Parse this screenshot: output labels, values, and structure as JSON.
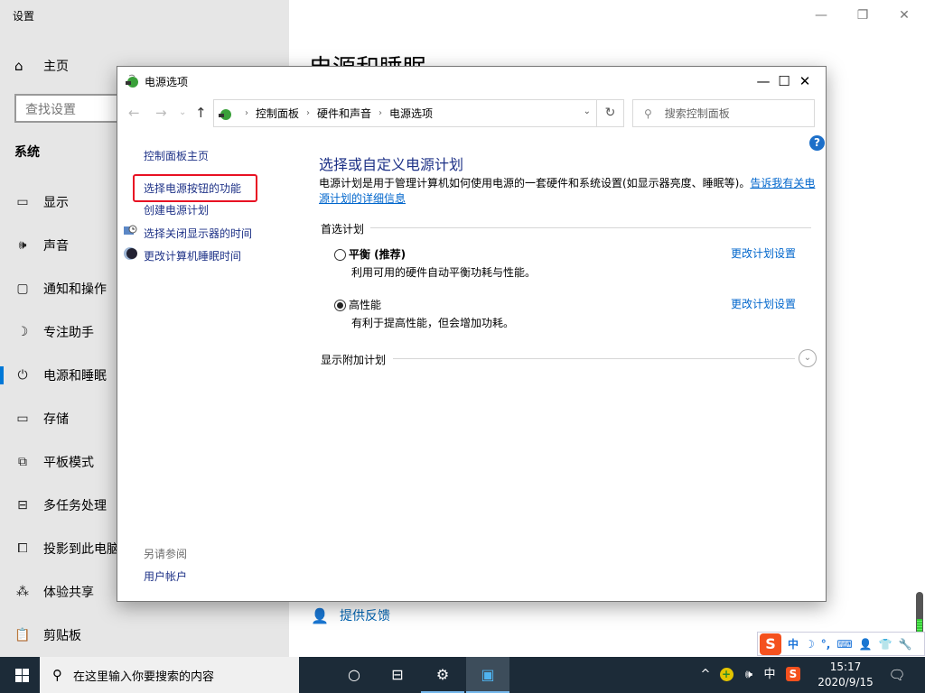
{
  "settings": {
    "window_title": "设置",
    "home_label": "主页",
    "search_placeholder": "查找设置",
    "section_label": "系统",
    "heading": "电源和睡眠",
    "feedback_label": "提供反馈",
    "nav_items": [
      {
        "label": "显示",
        "icon": "monitor-icon"
      },
      {
        "label": "声音",
        "icon": "speaker-icon"
      },
      {
        "label": "通知和操作",
        "icon": "notification-icon"
      },
      {
        "label": "专注助手",
        "icon": "moon-icon"
      },
      {
        "label": "电源和睡眠",
        "icon": "power-icon",
        "active": true
      },
      {
        "label": "存储",
        "icon": "storage-icon"
      },
      {
        "label": "平板模式",
        "icon": "tablet-mode-icon"
      },
      {
        "label": "多任务处理",
        "icon": "multitasking-icon"
      },
      {
        "label": "投影到此电脑",
        "icon": "project-icon"
      },
      {
        "label": "体验共享",
        "icon": "share-icon"
      },
      {
        "label": "剪贴板",
        "icon": "clipboard-icon"
      }
    ],
    "controls": {
      "minimize": "—",
      "restore": "❐",
      "close": "✕"
    }
  },
  "control_panel": {
    "window_title": "电源选项",
    "controls": {
      "minimize": "—",
      "maximize": "☐",
      "close": "✕"
    },
    "nav": {
      "back": "←",
      "forward": "→",
      "recent": "⌄",
      "up": "↑"
    },
    "breadcrumb": [
      "控制面板",
      "硬件和声音",
      "电源选项"
    ],
    "search_placeholder": "搜索控制面板",
    "help": "?",
    "left_nav": {
      "home": "控制面板主页",
      "items": [
        {
          "label": "选择电源按钮的功能",
          "highlighted": true
        },
        {
          "label": "创建电源计划"
        },
        {
          "label": "选择关闭显示器的时间",
          "icon": "display-timer-icon"
        },
        {
          "label": "更改计算机睡眠时间",
          "icon": "sleep-moon-icon"
        }
      ],
      "see_also": "另请参阅",
      "user_accounts": "用户帐户"
    },
    "main": {
      "title": "选择或自定义电源计划",
      "description": "电源计划是用于管理计算机如何使用电源的一套硬件和系统设置(如显示器亮度、睡眠等)。",
      "description_link": "告诉我有关电源计划的详细信息",
      "preferred_header": "首选计划",
      "plans": [
        {
          "name": "平衡 (推荐)",
          "desc": "利用可用的硬件自动平衡功耗与性能。",
          "selected": false,
          "link": "更改计划设置"
        },
        {
          "name": "高性能",
          "desc": "有利于提高性能，但会增加功耗。",
          "selected": true,
          "link": "更改计划设置"
        }
      ],
      "additional_header": "显示附加计划"
    }
  },
  "ime_bar": {
    "logo": "S",
    "items": [
      "中",
      "☽",
      "°,",
      "⌨",
      "👤",
      "👕",
      "🔧"
    ]
  },
  "taskbar": {
    "search_placeholder": "在这里输入你要搜索的内容",
    "tray": {
      "chevron": "^",
      "ime_lang": "中",
      "time": "15:17",
      "date": "2020/9/15"
    }
  },
  "colors": {
    "accent": "#0078d7",
    "link": "#0066cc",
    "cp_title": "#1e3287",
    "highlight_box": "#e81123",
    "taskbar": "#1c2b38"
  }
}
